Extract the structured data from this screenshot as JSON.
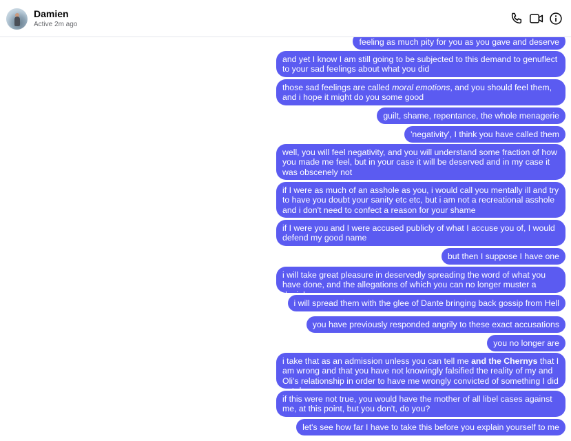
{
  "header": {
    "contact_name": "Damien",
    "status": "Active 2m ago",
    "icons": [
      "phone-icon",
      "video-camera-icon",
      "info-icon"
    ]
  },
  "colors": {
    "bubble": "#5b5bf1",
    "bubble_text": "#ffffff"
  },
  "messages": [
    {
      "text": "feeling as much pity for you as you gave and deserve"
    },
    {
      "text": "and yet I know I am still going to be subjected to this demand to genuflect to your sad feelings about what you did"
    },
    {
      "text_before": "those sad feelings are called ",
      "text_emph": "moral emotions",
      "text_after": ", and you should feel them, and i hope it might do you some good"
    },
    {
      "text": "guilt, shame, repentance, the whole menagerie"
    },
    {
      "text": "'negativity', I think you have called them"
    },
    {
      "text": "well, you will feel negativity, and you will understand some fraction of how you made me feel, but in your case it will be deserved and in my case it was obscenely not"
    },
    {
      "text": "if I were as much of an asshole as you, i would call you mentally ill and try to have you doubt your sanity etc etc, but i am not a recreational asshole and i don't need to confect a reason for your shame"
    },
    {
      "text": "if I were you and I were accused publicly of what I accuse you of, I would defend my good name"
    },
    {
      "text": "but then I suppose I have one"
    },
    {
      "text": "i will take great pleasure in deservedly spreading the word of what you have done, and the allegations of which you can no longer muster a denial"
    },
    {
      "text": "i will spread them with the glee of Dante bringing back gossip from Hell"
    },
    {
      "text": "you have previously responded angrily to these exact accusations"
    },
    {
      "text": "you no longer are"
    },
    {
      "text_before": "i take that as an admission unless you can tell me ",
      "text_bold": "and the Chernys",
      "text_after": " that I am wrong and that you have not knowingly falsified the reality of my and Oli's relationship in order to have me wrongly convicted of something I did not do"
    },
    {
      "text": "if this were not true, you would have the mother of all libel cases against me, at this point, but you don't, do you?"
    },
    {
      "text": "let's see how far I have to take this before you explain yourself to me"
    }
  ]
}
